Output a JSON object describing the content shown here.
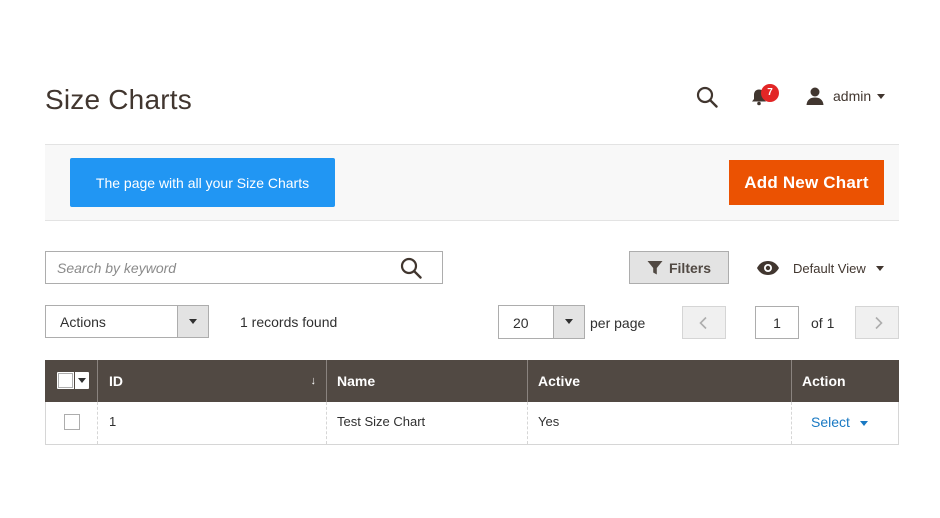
{
  "header": {
    "title": "Size Charts",
    "notification_count": "7",
    "user_name": "admin",
    "icons": [
      "search-icon",
      "bell-icon",
      "user-icon"
    ]
  },
  "toolbar": {
    "info_label": "The page with all your Size Charts",
    "add_label": "Add New Chart",
    "colors": {
      "info": "#2196f3",
      "add": "#eb5202"
    }
  },
  "search": {
    "placeholder": "Search by keyword",
    "value": ""
  },
  "filters": {
    "label": "Filters",
    "view_label": "Default View"
  },
  "actions": {
    "selected": "Actions"
  },
  "records": {
    "text": "1 records found"
  },
  "pagination": {
    "per_page_value": "20",
    "per_page_label": "per page",
    "current_page": "1",
    "total_label": "of 1"
  },
  "grid": {
    "columns": [
      "ID",
      "Name",
      "Active",
      "Action"
    ],
    "sort_indicator": "↓",
    "rows": [
      {
        "id": "1",
        "name": "Test Size Chart",
        "active": "Yes",
        "action": "Select"
      }
    ]
  }
}
